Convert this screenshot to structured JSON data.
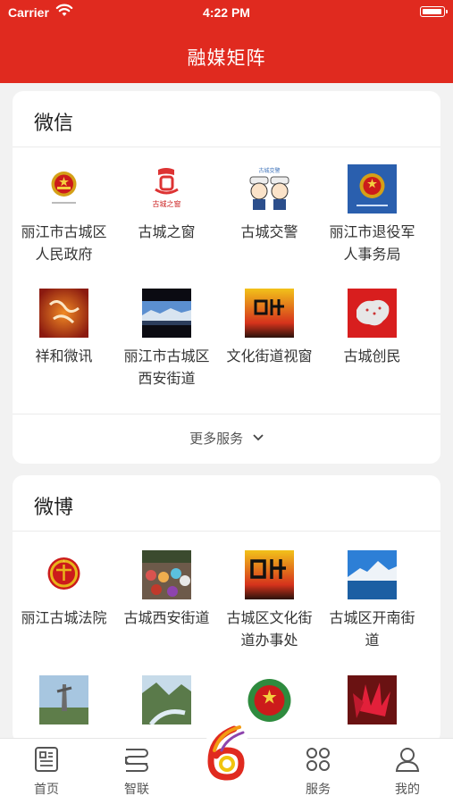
{
  "status_bar": {
    "carrier": "Carrier",
    "time": "4:22 PM"
  },
  "header": {
    "title": "融媒矩阵"
  },
  "wechat": {
    "title": "微信",
    "items": [
      {
        "label": "丽江市古城区人民政府",
        "icon": "national-emblem-icon"
      },
      {
        "label": "古城之窗",
        "icon": "gucheng-window-logo"
      },
      {
        "label": "古城交警",
        "icon": "traffic-police-icon"
      },
      {
        "label": "丽江市退役军人事务局",
        "icon": "veterans-affairs-emblem"
      },
      {
        "label": "祥和微讯",
        "icon": "xianghe-calligraphy-thumbnail"
      },
      {
        "label": "丽江市古城区西安街道",
        "icon": "city-night-thumbnail"
      },
      {
        "label": "文化街道视窗",
        "icon": "culture-street-thumbnail"
      },
      {
        "label": "古城创民",
        "icon": "china-map-thumbnail"
      }
    ],
    "logo_texts": {
      "gucheng": "古城之窗",
      "traffic": "古城交警"
    },
    "more_label": "更多服务"
  },
  "weibo": {
    "title": "微博",
    "items": [
      {
        "label": "丽江古城法院",
        "icon": "court-emblem-icon"
      },
      {
        "label": "古城西安街道",
        "icon": "crowd-photo-thumbnail"
      },
      {
        "label": "古城区文化街道办事处",
        "icon": "culture-street-thumbnail"
      },
      {
        "label": "古城区开南街道",
        "icon": "mountain-lake-thumbnail"
      },
      {
        "label": "",
        "icon": "monument-thumbnail"
      },
      {
        "label": "",
        "icon": "river-valley-thumbnail"
      },
      {
        "label": "",
        "icon": "national-emblem-icon"
      },
      {
        "label": "",
        "icon": "red-leaves-thumbnail"
      }
    ]
  },
  "tabbar": {
    "tabs": [
      {
        "label": "首页",
        "icon": "news-icon"
      },
      {
        "label": "智联",
        "icon": "connect-icon"
      },
      {
        "label": "服务",
        "icon": "grid-icon"
      },
      {
        "label": "我的",
        "icon": "user-icon"
      }
    ],
    "center_icon": "app-logo-icon"
  },
  "colors": {
    "brand": "#e02a1f",
    "background": "#f2f2f2"
  }
}
